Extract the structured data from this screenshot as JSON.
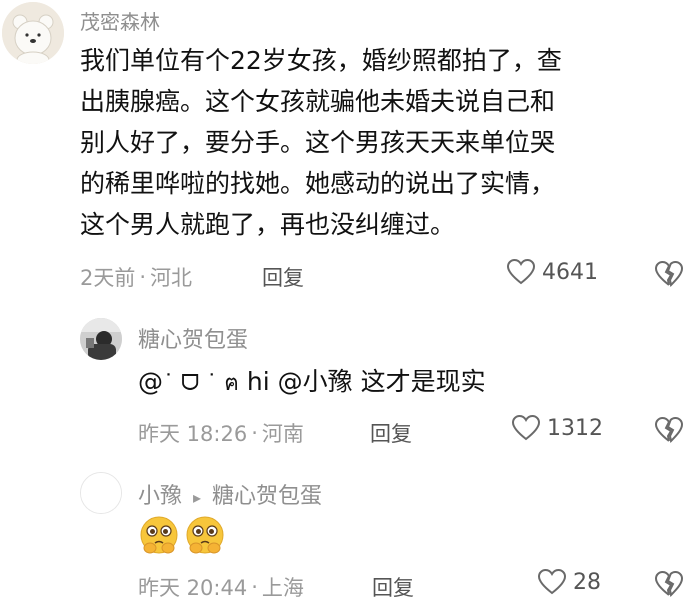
{
  "comments": [
    {
      "username": "茂密森林",
      "lines": [
        "我们单位有个22岁女孩，婚纱照都拍了，查",
        "出胰腺癌。这个女孩就骗他未婚夫说自己和",
        "别人好了，要分手。这个男孩天天来单位哭",
        "的稀里哗啦的找她。她感动的说出了实情，",
        "这个男人就跑了，再也没纠缠过。"
      ],
      "time": "2天前",
      "separator": "·",
      "location": "河北",
      "reply_label": "回复",
      "like_count": "4641"
    },
    {
      "username": "糖心贺包蛋",
      "text_prefix": "@",
      "text_emoticon": "˙ ᗜ ˙ ฅ",
      "text_hi": " hi ",
      "text_mention": "@小豫",
      "text_rest": " 这才是现实",
      "time": "昨天 18:26",
      "separator": "·",
      "location": "河南",
      "reply_label": "回复",
      "like_count": "1312"
    },
    {
      "username": "小豫",
      "reply_arrow": "▸",
      "reply_to": "糖心贺包蛋",
      "emojis": [
        "pleading-emoji",
        "pleading-emoji"
      ],
      "time": "昨天 20:44",
      "separator": "·",
      "location": "上海",
      "reply_label": "回复",
      "like_count": "28"
    }
  ]
}
